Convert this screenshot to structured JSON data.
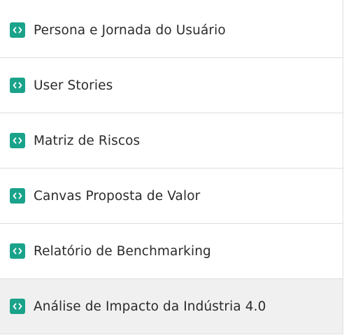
{
  "list": {
    "items": [
      {
        "label": "Persona e Jornada do Usuário",
        "icon": "code-icon"
      },
      {
        "label": "User Stories",
        "icon": "code-icon"
      },
      {
        "label": "Matriz de Riscos",
        "icon": "code-icon"
      },
      {
        "label": "Canvas Proposta de Valor",
        "icon": "code-icon"
      },
      {
        "label": "Relatório de Benchmarking",
        "icon": "code-icon"
      },
      {
        "label": "Análise de Impacto da Indústria 4.0",
        "icon": "code-icon",
        "selected": true
      }
    ]
  },
  "colors": {
    "icon_background": "#1aa38a",
    "selected_row_background": "#f0f0f0",
    "divider": "#dedede",
    "text": "#2b2b2b"
  }
}
